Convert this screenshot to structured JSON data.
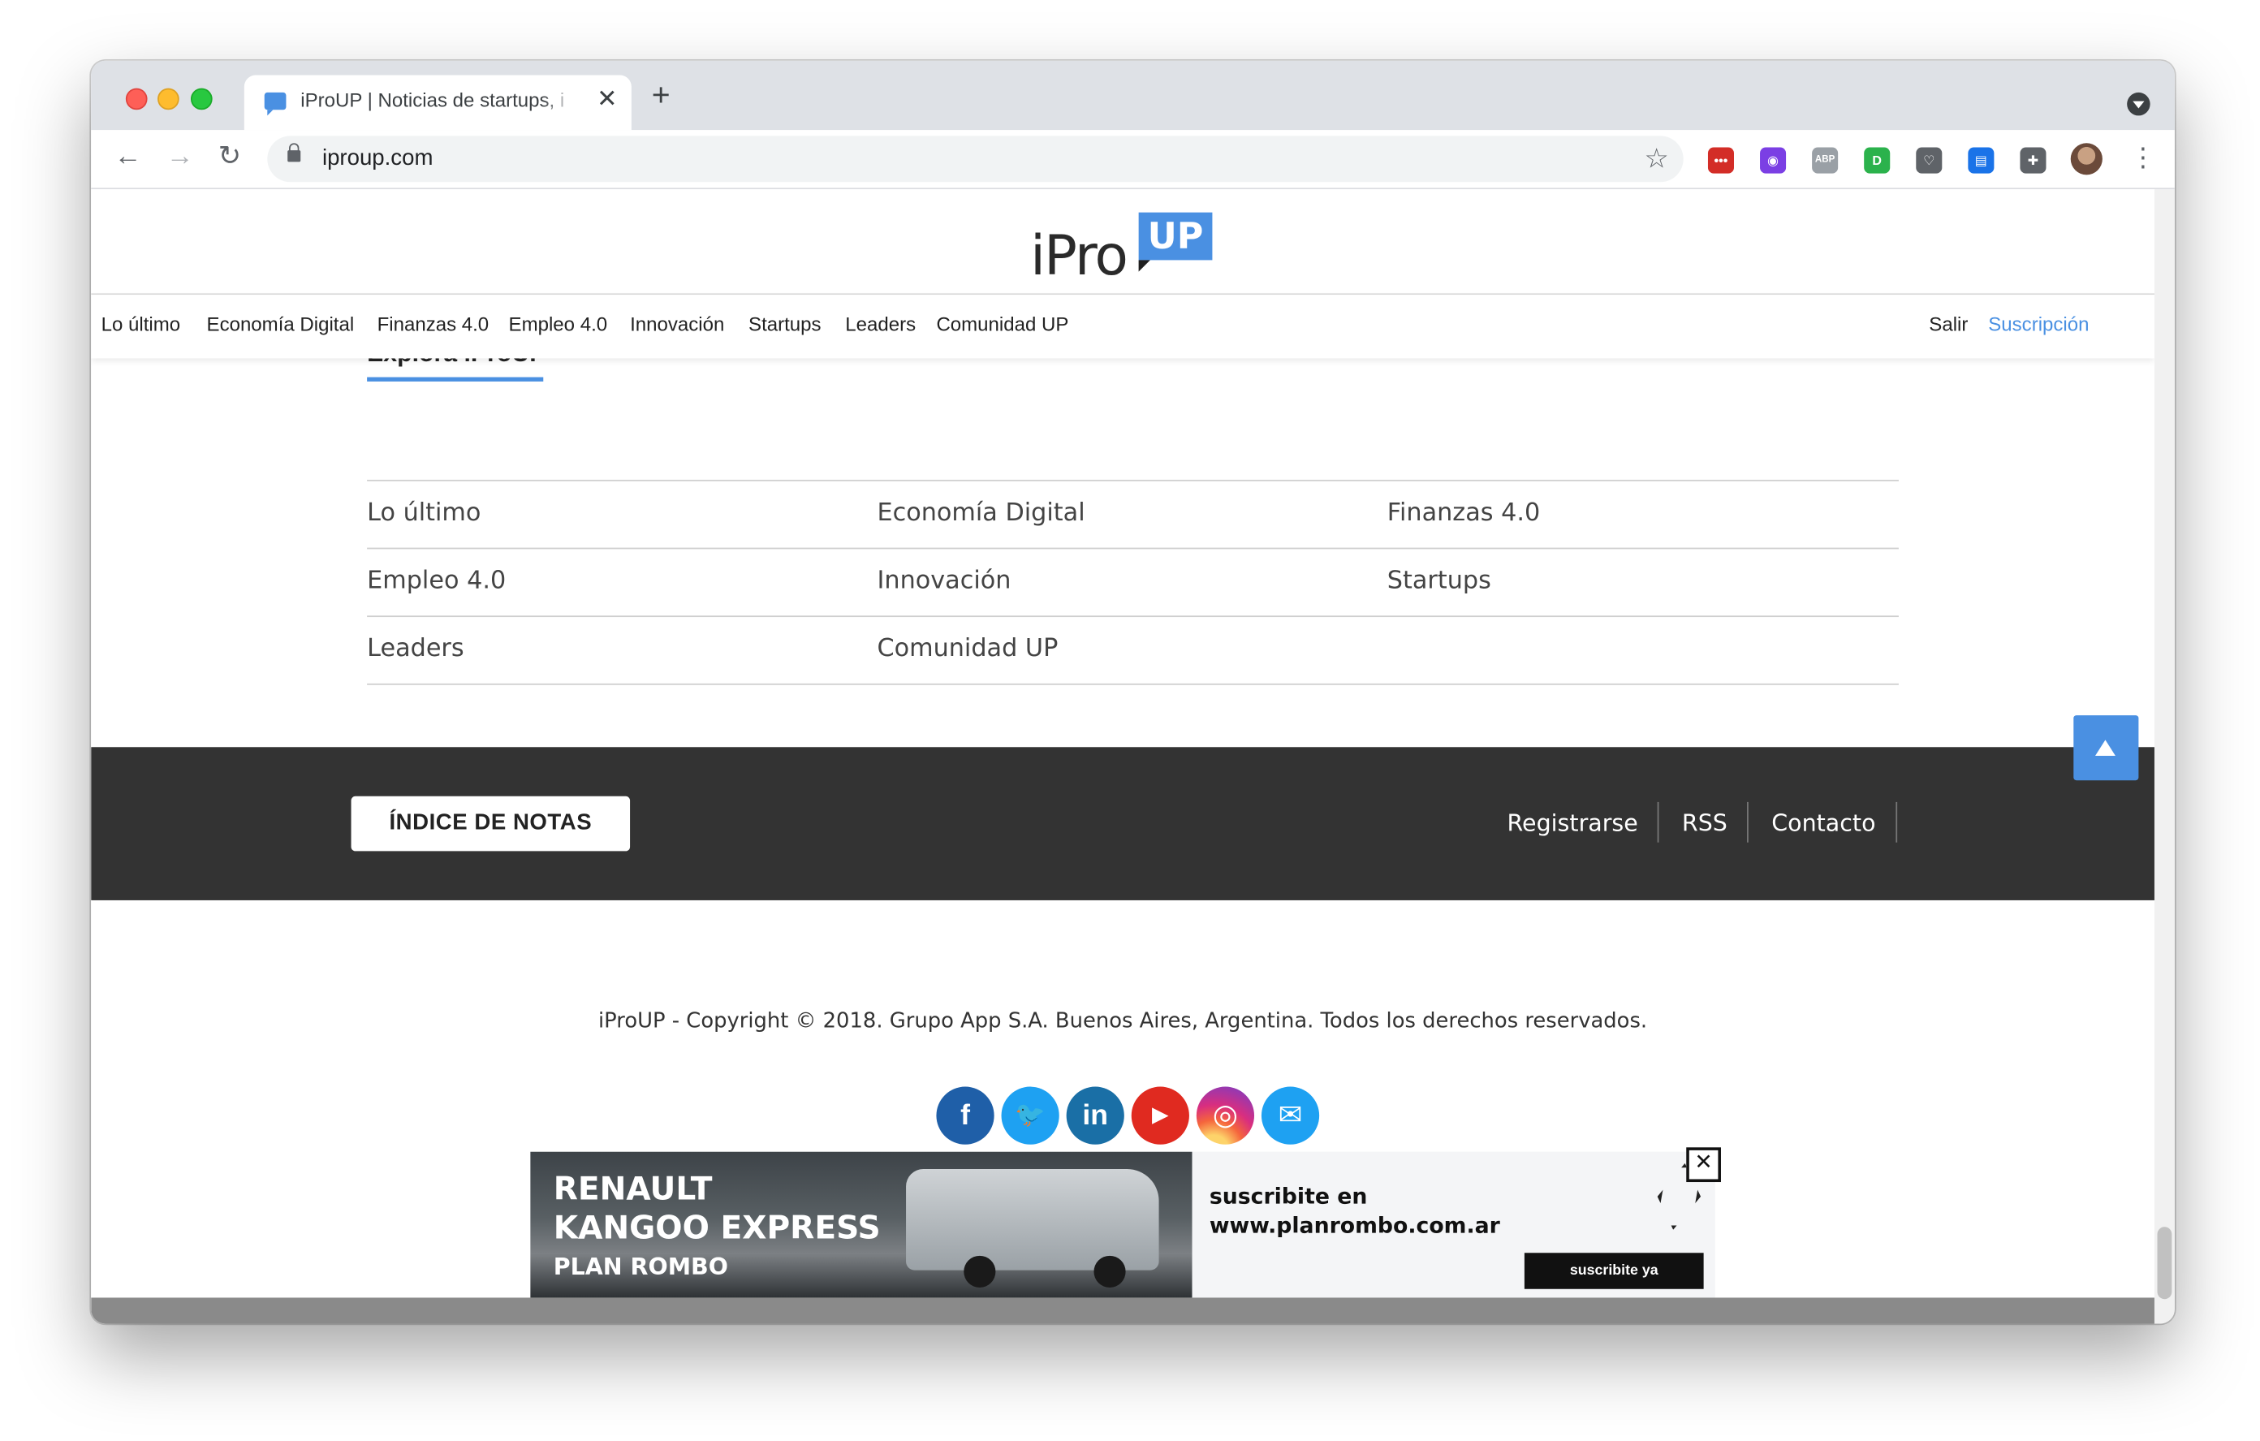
{
  "browser": {
    "tab_title": "iProUP | Noticias de startups, i",
    "tab_close": "✕",
    "new_tab": "+",
    "url": "iproup.com",
    "back": "←",
    "forward": "→",
    "reload": "↻",
    "star": "☆",
    "menu": "⋮",
    "extensions": [
      {
        "name": "lastpass-icon",
        "text": "•••",
        "color": "#d32d27"
      },
      {
        "name": "color-picker-icon",
        "text": "◉",
        "color": "#7b3fe4"
      },
      {
        "name": "adblock-icon",
        "text": "ABP",
        "color": "#9aa0a6"
      },
      {
        "name": "extension-green-icon",
        "text": "D",
        "color": "#2bb24c"
      },
      {
        "name": "pocket-icon",
        "text": "♡",
        "color": "#5f6368"
      },
      {
        "name": "reader-icon",
        "text": "▤",
        "color": "#1a73e8"
      },
      {
        "name": "extensions-puzzle-icon",
        "text": "✚",
        "color": "#5f6368"
      }
    ]
  },
  "site": {
    "logo_text": "iPro",
    "logo_badge": "UP",
    "nav": [
      "Lo último",
      "Economía Digital",
      "Finanzas 4.0",
      "Empleo 4.0",
      "Innovación",
      "Startups",
      "Leaders",
      "Comunidad UP"
    ],
    "salir": "Salir",
    "suscripcion": "Suscripción"
  },
  "explora": {
    "heading": "Explora iProUP",
    "topics": [
      [
        "Lo último",
        "Economía Digital",
        "Finanzas 4.0"
      ],
      [
        "Empleo 4.0",
        "Innovación",
        "Startups"
      ],
      [
        "Leaders",
        "Comunidad UP",
        ""
      ]
    ]
  },
  "footer": {
    "indice_label": "ÍNDICE DE NOTAS",
    "links": [
      "Registrarse",
      "RSS",
      "Contacto"
    ],
    "copyright": "iProUP - Copyright © 2018.  Grupo App S.A.  Buenos Aires, Argentina. Todos los derechos reservados.",
    "social": [
      {
        "name": "facebook-icon",
        "glyph": "f"
      },
      {
        "name": "twitter-icon",
        "glyph": "🐦"
      },
      {
        "name": "linkedin-icon",
        "glyph": "in"
      },
      {
        "name": "youtube-icon",
        "glyph": "▶"
      },
      {
        "name": "instagram-icon",
        "glyph": "◎"
      },
      {
        "name": "mail-icon",
        "glyph": "✉"
      }
    ]
  },
  "ad": {
    "title1": "RENAULT",
    "title2": "KANGOO EXPRESS",
    "title3": "PLAN ROMBO",
    "text1": "suscribite en",
    "text2": "www.planrombo.com.ar",
    "cta": "suscribite ya",
    "close": "✕"
  },
  "colors": {
    "accent": "#4a90e2",
    "footer_bg": "#333333"
  }
}
